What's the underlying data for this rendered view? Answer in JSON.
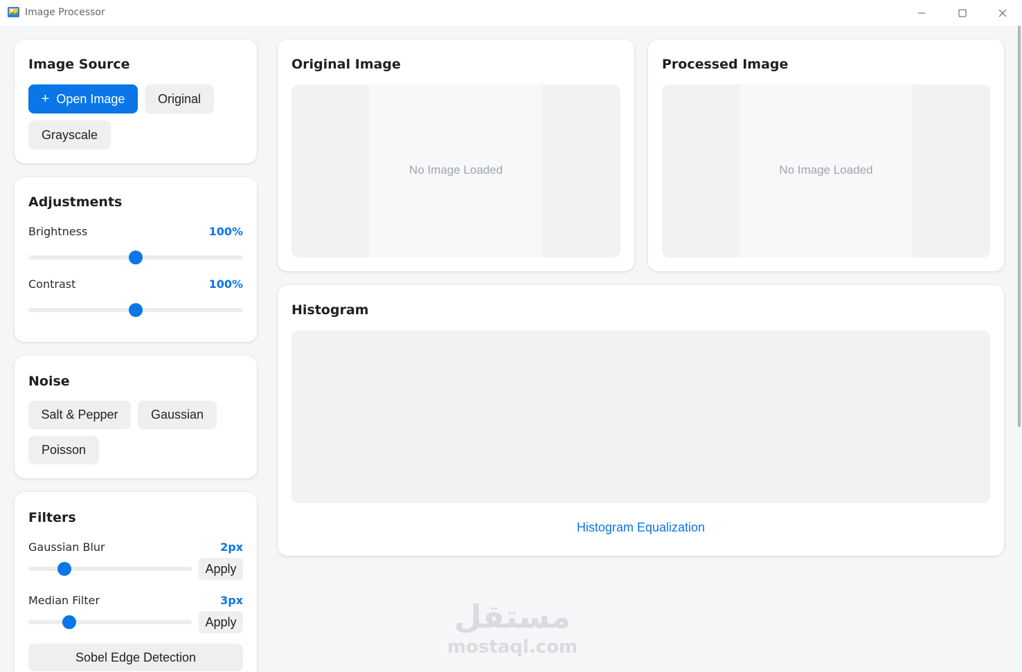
{
  "window": {
    "title": "Image Processor",
    "controls": {
      "minimize": "—",
      "maximize": "☐",
      "close": "✕"
    }
  },
  "image_source": {
    "title": "Image Source",
    "open_label": "Open Image",
    "open_icon": "+",
    "original_label": "Original",
    "grayscale_label": "Grayscale"
  },
  "adjustments": {
    "title": "Adjustments",
    "brightness": {
      "label": "Brightness",
      "value": "100%",
      "level": 0.5
    },
    "contrast": {
      "label": "Contrast",
      "value": "100%",
      "level": 0.5
    }
  },
  "noise": {
    "title": "Noise",
    "salt_pepper_label": "Salt & Pepper",
    "gaussian_label": "Gaussian",
    "poisson_label": "Poisson"
  },
  "filters": {
    "title": "Filters",
    "gaussian_blur": {
      "label": "Gaussian Blur",
      "value": "2px",
      "apply_label": "Apply",
      "level": 0.22
    },
    "median_filter": {
      "label": "Median Filter",
      "value": "3px",
      "apply_label": "Apply",
      "level": 0.25
    },
    "sobel_label": "Sobel Edge Detection"
  },
  "original_panel": {
    "title": "Original Image",
    "placeholder": "No Image Loaded"
  },
  "processed_panel": {
    "title": "Processed Image",
    "placeholder": "No Image Loaded"
  },
  "histogram": {
    "title": "Histogram",
    "equalize_label": "Histogram Equalization"
  },
  "watermark": {
    "arabic": "مستقل",
    "latin": "mostaql.com"
  },
  "colors": {
    "accent": "#0a76e8",
    "button_bg": "#efefef",
    "panel_bg": "#f1f2f4"
  }
}
